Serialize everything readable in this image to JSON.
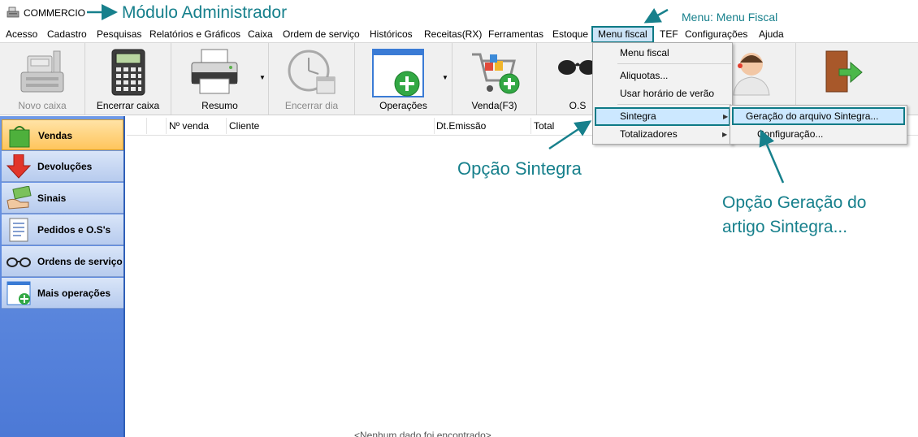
{
  "window": {
    "title": "COMMERCIO"
  },
  "menubar": {
    "items": [
      "Acesso",
      "Cadastro",
      "Pesquisas",
      "Relatórios e Gráficos",
      "Caixa",
      "Ordem de serviço",
      "Históricos",
      "Receitas(RX)",
      "Ferramentas",
      "Estoque",
      "Menu fiscal",
      "TEF",
      "Configurações",
      "Ajuda"
    ]
  },
  "toolbar": {
    "novo_caixa": "Novo caixa",
    "encerrar_caixa": "Encerrar caixa",
    "resumo": "Resumo",
    "encerrar_dia": "Encerrar dia",
    "operacoes": "Operações",
    "venda": "Venda(F3)",
    "os": "O.S"
  },
  "sidebar": {
    "items": [
      "Vendas",
      "Devoluções",
      "Sinais",
      "Pedidos e O.S's",
      "Ordens de serviço",
      "Mais operações"
    ]
  },
  "grid": {
    "columns": [
      "Nº venda",
      "Cliente",
      "Dt.Emissão",
      "Total"
    ],
    "empty_message": "<Nenhum dado foi encontrado>"
  },
  "menu_fiscal": {
    "items": [
      "Menu fiscal",
      "Aliquotas...",
      "Usar horário de verão",
      "Sintegra",
      "Totalizadores"
    ]
  },
  "sintegra_submenu": {
    "items": [
      "Geração do arquivo Sintegra...",
      "Configuração..."
    ]
  },
  "annotations": {
    "modulo": "Módulo Administrador",
    "menu": "Menu: Menu Fiscal",
    "opcao_sintegra": "Opção Sintegra",
    "opcao_geracao_1": "Opção Geração do",
    "opcao_geracao_2": "artigo Sintegra..."
  },
  "colors": {
    "annotation": "#17808c",
    "highlight_border": "#0e7a86",
    "sidebar": "#5a86dc",
    "selected": "#ffc55c"
  }
}
